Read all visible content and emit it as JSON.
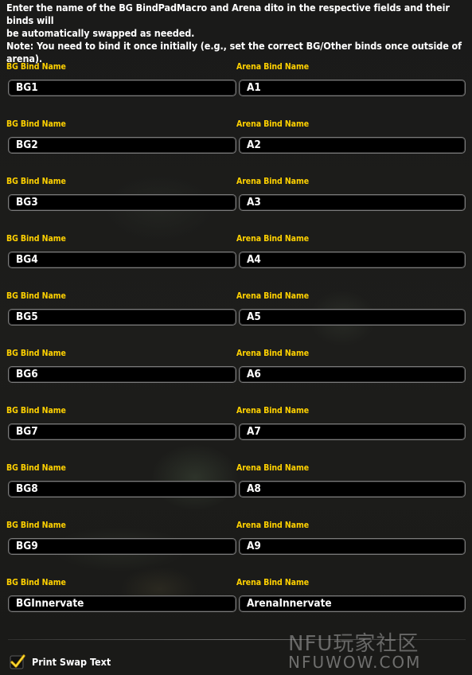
{
  "instructions": {
    "line1": "Enter the name of the BG BindPadMacro and Arena dito in the respective fields and their binds will",
    "line2": "be automatically swapped as needed.",
    "note": "Note: You need to bind it once initially (e.g., set the correct BG/Other binds once outside of arena)."
  },
  "rows": [
    {
      "bg_label": "BG Bind Name",
      "bg_value": "BG1",
      "arena_label": "Arena Bind Name",
      "arena_value": "A1"
    },
    {
      "bg_label": "BG Bind Name",
      "bg_value": "BG2",
      "arena_label": "Arena Bind Name",
      "arena_value": "A2"
    },
    {
      "bg_label": "BG Bind Name",
      "bg_value": "BG3",
      "arena_label": "Arena Bind Name",
      "arena_value": "A3"
    },
    {
      "bg_label": "BG Bind Name",
      "bg_value": "BG4",
      "arena_label": "Arena Bind Name",
      "arena_value": "A4"
    },
    {
      "bg_label": "BG Bind Name",
      "bg_value": "BG5",
      "arena_label": "Arena Bind Name",
      "arena_value": "A5"
    },
    {
      "bg_label": "BG Bind Name",
      "bg_value": "BG6",
      "arena_label": "Arena Bind Name",
      "arena_value": "A6"
    },
    {
      "bg_label": "BG Bind Name",
      "bg_value": "BG7",
      "arena_label": "Arena Bind Name",
      "arena_value": "A7"
    },
    {
      "bg_label": "BG Bind Name",
      "bg_value": "BG8",
      "arena_label": "Arena Bind Name",
      "arena_value": "A8"
    },
    {
      "bg_label": "BG Bind Name",
      "bg_value": "BG9",
      "arena_label": "Arena Bind Name",
      "arena_value": "A9"
    },
    {
      "bg_label": "BG Bind Name",
      "bg_value": "BGInnervate",
      "arena_label": "Arena Bind Name",
      "arena_value": "ArenaInnervate"
    }
  ],
  "print_swap": {
    "label": "Print Swap Text",
    "checked": true
  },
  "watermark": {
    "top": "NFU玩家社区",
    "bottom": "NFUWOW.COM"
  },
  "colors": {
    "label": "#ffd100",
    "text": "#ffffff",
    "check": "#ffd100"
  },
  "icons": {
    "checkbox": "checkmark-icon"
  }
}
